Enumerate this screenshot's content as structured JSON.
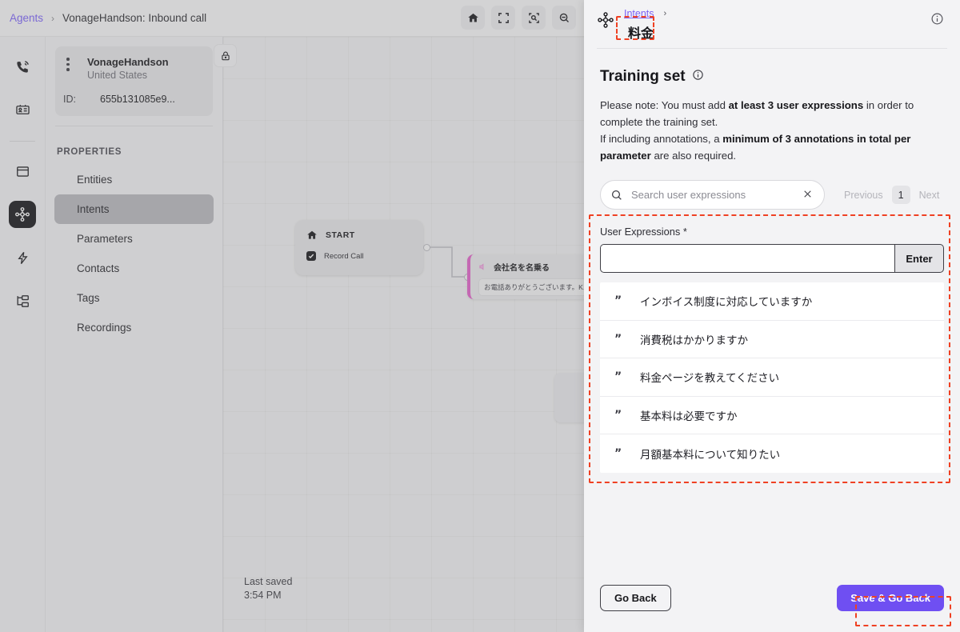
{
  "topbar": {
    "breadcrumb_root": "Agents",
    "breadcrumb_sep": "›",
    "breadcrumb_current": "VonageHandson: Inbound call",
    "tools": [
      {
        "name": "home-icon",
        "label": "Home"
      },
      {
        "name": "fit-screen-icon",
        "label": "Fit to screen"
      },
      {
        "name": "focus-zoom-icon",
        "label": "Focus"
      },
      {
        "name": "zoom-out-icon",
        "label": "Zoom out"
      }
    ]
  },
  "rail": {
    "items": [
      {
        "name": "phone-call-icon",
        "label": "Calls",
        "active": false
      },
      {
        "name": "id-card-icon",
        "label": "Contacts",
        "active": false
      },
      {
        "name": "panel-icon",
        "label": "Panels",
        "active": false
      },
      {
        "name": "node-hub-icon",
        "label": "Agent designer",
        "active": true
      },
      {
        "name": "lightning-icon",
        "label": "Events",
        "active": false
      },
      {
        "name": "hierarchy-icon",
        "label": "Flows",
        "active": false
      }
    ]
  },
  "sidebar": {
    "agent": {
      "name": "VonageHandson",
      "country": "United States",
      "id_label": "ID:",
      "id_value": "655b131085e9..."
    },
    "lock_icon": "lock-icon",
    "section_title": "PROPERTIES",
    "items": [
      {
        "label": "Entities",
        "active": false
      },
      {
        "label": "Intents",
        "active": true
      },
      {
        "label": "Parameters",
        "active": false
      },
      {
        "label": "Contacts",
        "active": false
      },
      {
        "label": "Tags",
        "active": false
      },
      {
        "label": "Recordings",
        "active": false
      }
    ]
  },
  "canvas": {
    "start_node": {
      "title": "START",
      "subtitle": "Record Call",
      "icon": "home-icon"
    },
    "speak_node": {
      "title": "会社名を名乗る",
      "body": "お電話ありがとうございます。K...",
      "icon": "speaker-icon",
      "accent_color": "#e060c8"
    },
    "last_saved_label": "Last saved",
    "last_saved_time": "3:54 PM"
  },
  "panel": {
    "icon": "node-hub-icon",
    "breadcrumb_link": "Intents",
    "breadcrumb_chevron": "›",
    "title": "料金",
    "info_icon": "info-icon",
    "training_set": {
      "heading": "Training set",
      "heading_info_icon": "info-icon",
      "note_line1_pre": "Please note: You must add ",
      "note_line1_bold": "at least 3 user expressions",
      "note_line1_post": " in order to complete the training set.",
      "note_line2_pre": "If including annotations, a ",
      "note_line2_bold": "minimum of 3 annotations in total per parameter",
      "note_line2_post": " are also required."
    },
    "search": {
      "icon": "search-icon",
      "placeholder": "Search user expressions",
      "value": "",
      "clear_icon": "close-icon"
    },
    "pagination": {
      "previous": "Previous",
      "current_page": "1",
      "next": "Next"
    },
    "user_expressions": {
      "label": "User Expressions *",
      "input_value": "",
      "enter_label": "Enter",
      "items": [
        "インボイス制度に対応していますか",
        "消費税はかかりますか",
        "料金ページを教えてください",
        "基本料は必要ですか",
        "月額基本料について知りたい"
      ],
      "item_icon": "quote-icon",
      "quote_glyph": "”"
    },
    "footer": {
      "go_back_label": "Go Back",
      "save_label": "Save & Go Back"
    }
  },
  "annotations": {
    "color": "#ef4123",
    "boxes": [
      {
        "name": "annotation-intent-title"
      },
      {
        "name": "annotation-user-expressions"
      },
      {
        "name": "annotation-save-button"
      }
    ]
  }
}
